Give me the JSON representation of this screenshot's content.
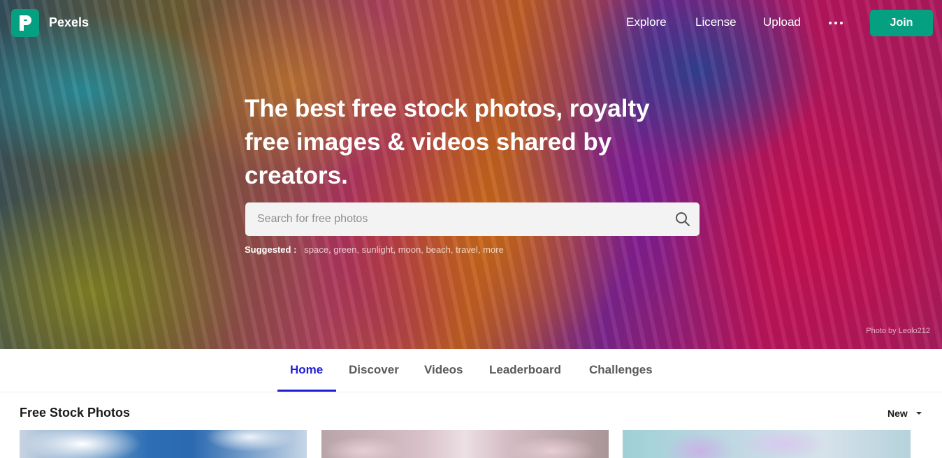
{
  "brand": {
    "name": "Pexels",
    "accent": "#05a081"
  },
  "nav": {
    "items": [
      "Explore",
      "License",
      "Upload"
    ],
    "more_icon": "more-horizontal-icon",
    "join_label": "Join"
  },
  "hero": {
    "headline": "The best free stock photos, royalty free images & videos shared by creators.",
    "search_placeholder": "Search for free photos",
    "search_icon": "search-icon",
    "suggested_label": "Suggested :",
    "suggested": [
      "space",
      "green",
      "sunlight",
      "moon",
      "beach",
      "travel",
      "more"
    ],
    "credit": "Photo by Leolo212"
  },
  "tabs": {
    "items": [
      "Home",
      "Discover",
      "Videos",
      "Leaderboard",
      "Challenges"
    ],
    "active": "Home",
    "active_color": "#1f1fd6"
  },
  "feed": {
    "title": "Free Stock Photos",
    "sort_label": "New"
  }
}
